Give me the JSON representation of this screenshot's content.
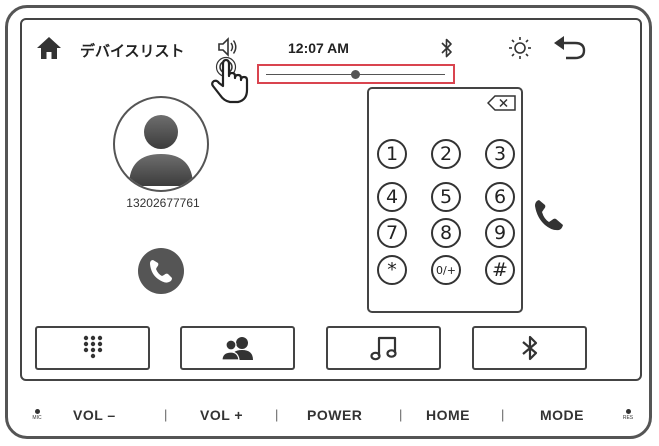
{
  "status_bar": {
    "title": "デバイスリスト",
    "time": "12:07 AM"
  },
  "volume": {
    "level": 0.5
  },
  "contact": {
    "phone_number": "13202677761"
  },
  "dialpad": {
    "keys": [
      "1",
      "2",
      "3",
      "4",
      "5",
      "6",
      "7",
      "8",
      "9",
      "*",
      "0/+",
      "#"
    ]
  },
  "hardware_buttons": {
    "mic": "MIC",
    "vol_down": "VOL –",
    "vol_up": "VOL +",
    "power": "POWER",
    "home": "HOME",
    "mode": "MODE",
    "res": "RES",
    "separator": "|"
  },
  "icons": {
    "home": "home-icon",
    "speaker": "speaker-icon",
    "bluetooth": "bluetooth-icon",
    "brightness": "brightness-icon",
    "back": "back-icon",
    "backspace": "backspace-icon",
    "call": "call-icon",
    "keypad": "keypad-icon",
    "contacts": "contacts-icon",
    "music": "music-icon",
    "pointer": "hand-pointer-icon"
  },
  "colors": {
    "highlight": "#d9444f",
    "icon": "#555555"
  }
}
